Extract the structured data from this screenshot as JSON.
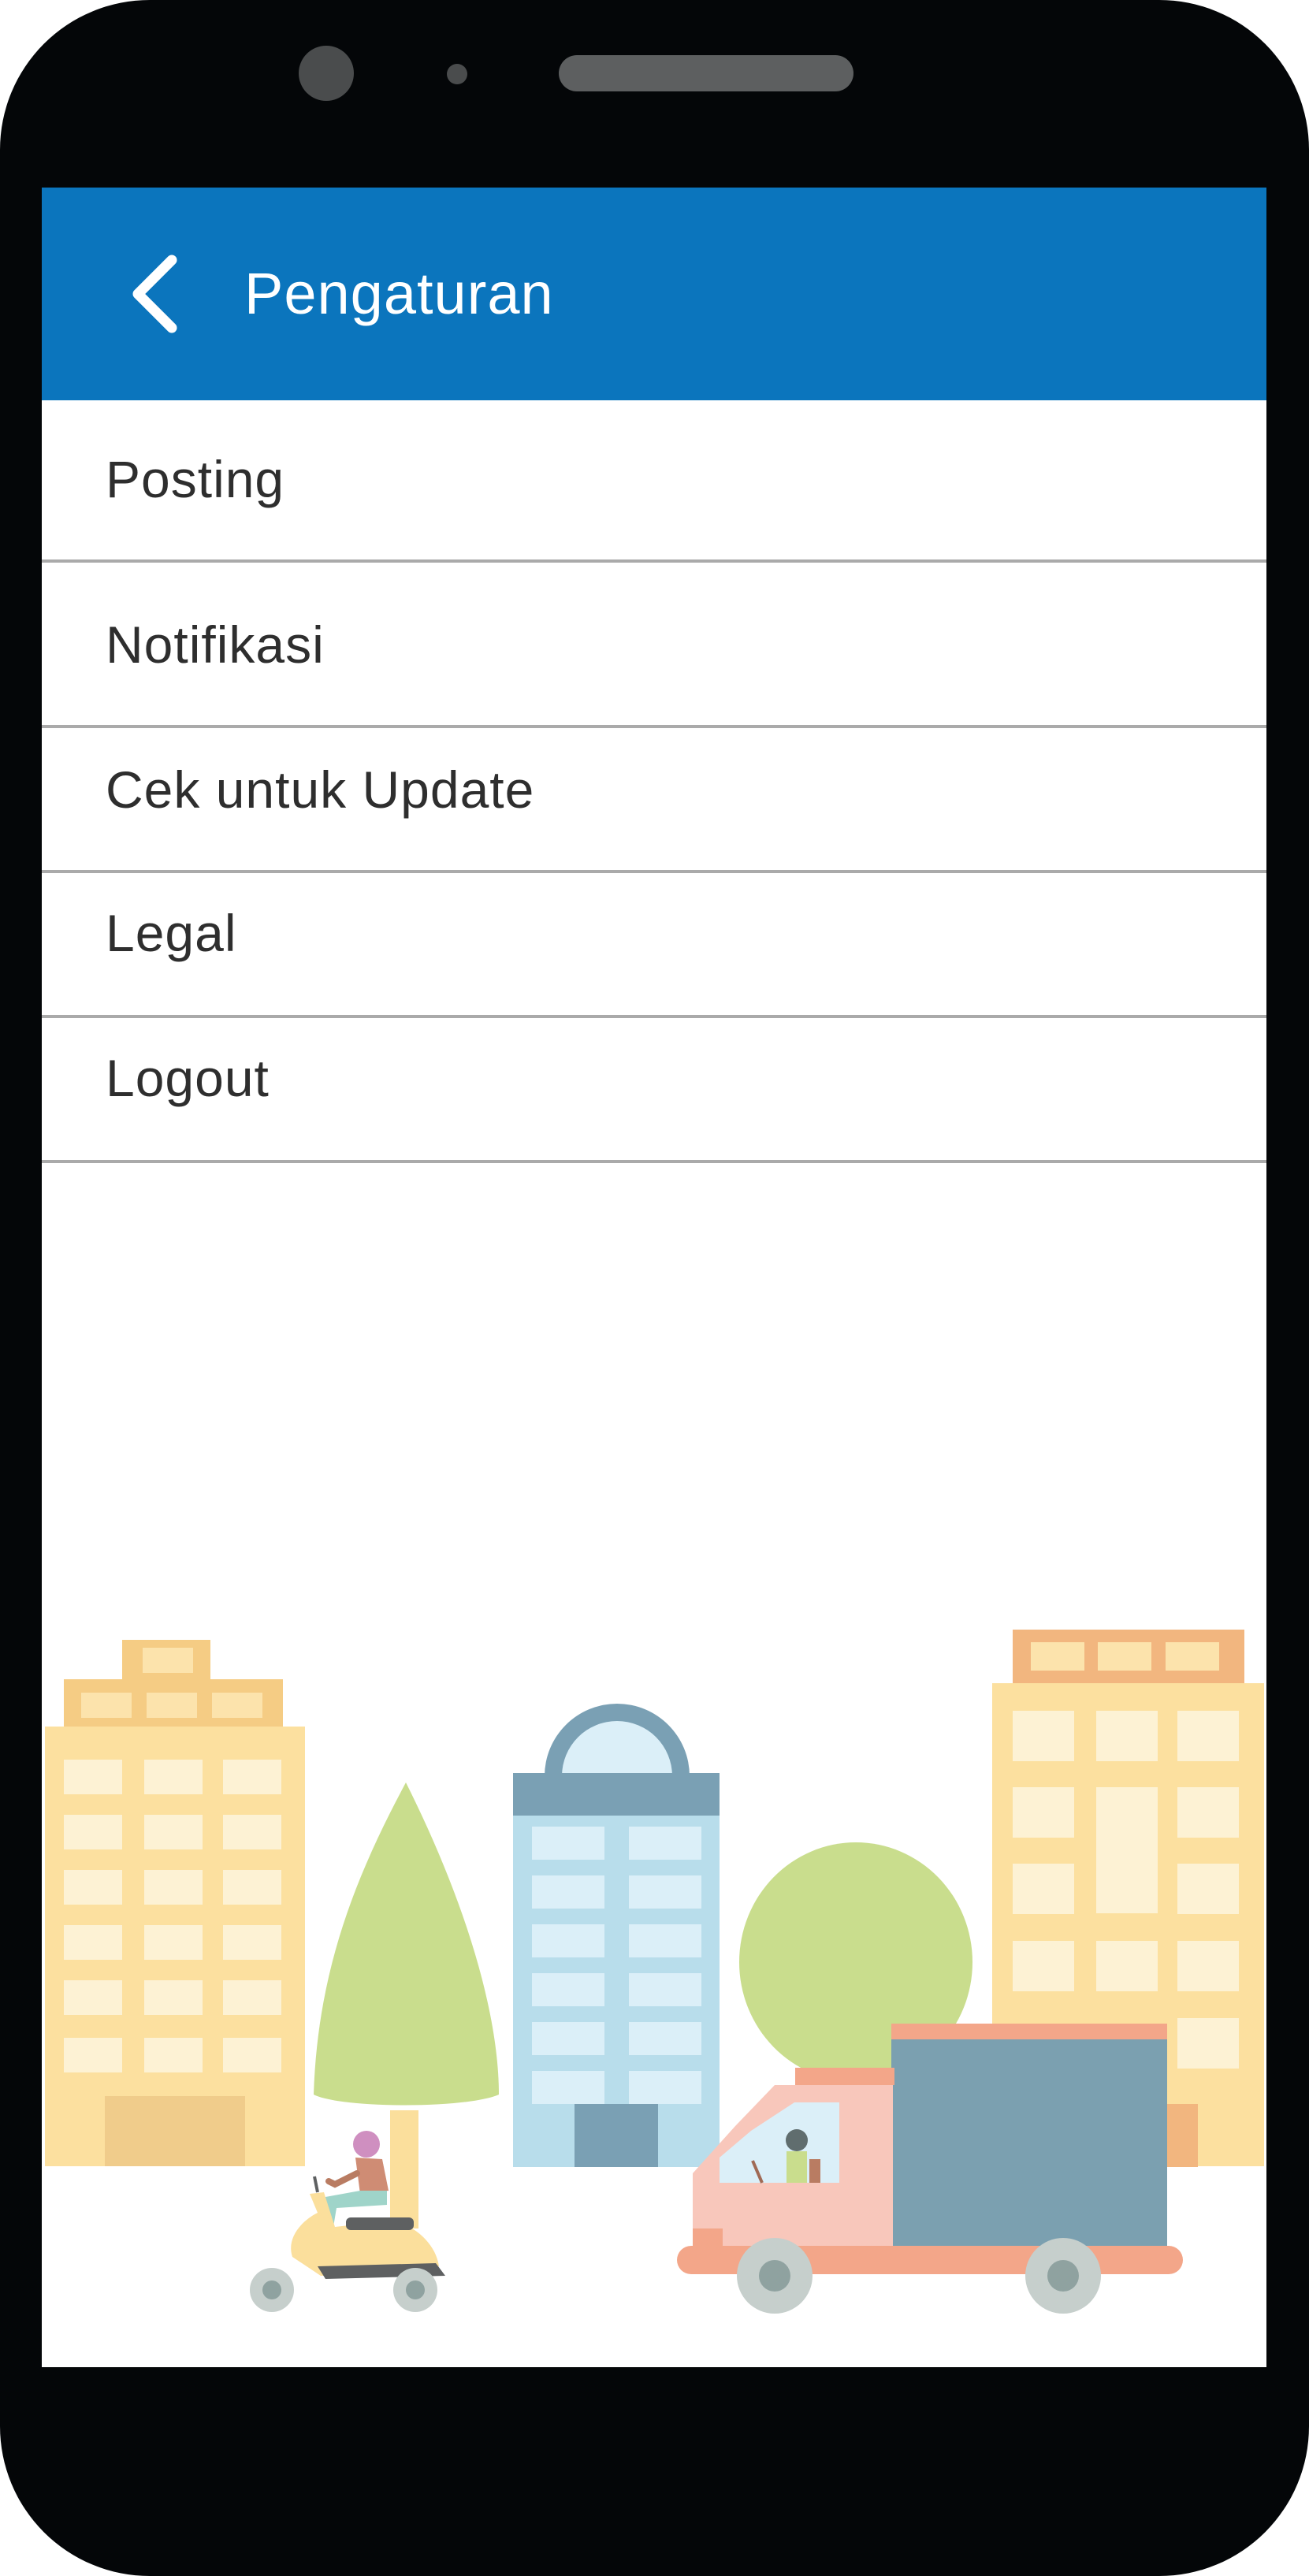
{
  "header": {
    "title": "Pengaturan",
    "back_icon": "chevron-left-icon",
    "background_color": "#0b75bd"
  },
  "menu": {
    "items": [
      {
        "label": "Posting"
      },
      {
        "label": "Notifikasi"
      },
      {
        "label": "Cek untuk Update"
      },
      {
        "label": "Legal"
      },
      {
        "label": "Logout"
      }
    ]
  },
  "illustration": {
    "name": "city-street-illustration"
  }
}
